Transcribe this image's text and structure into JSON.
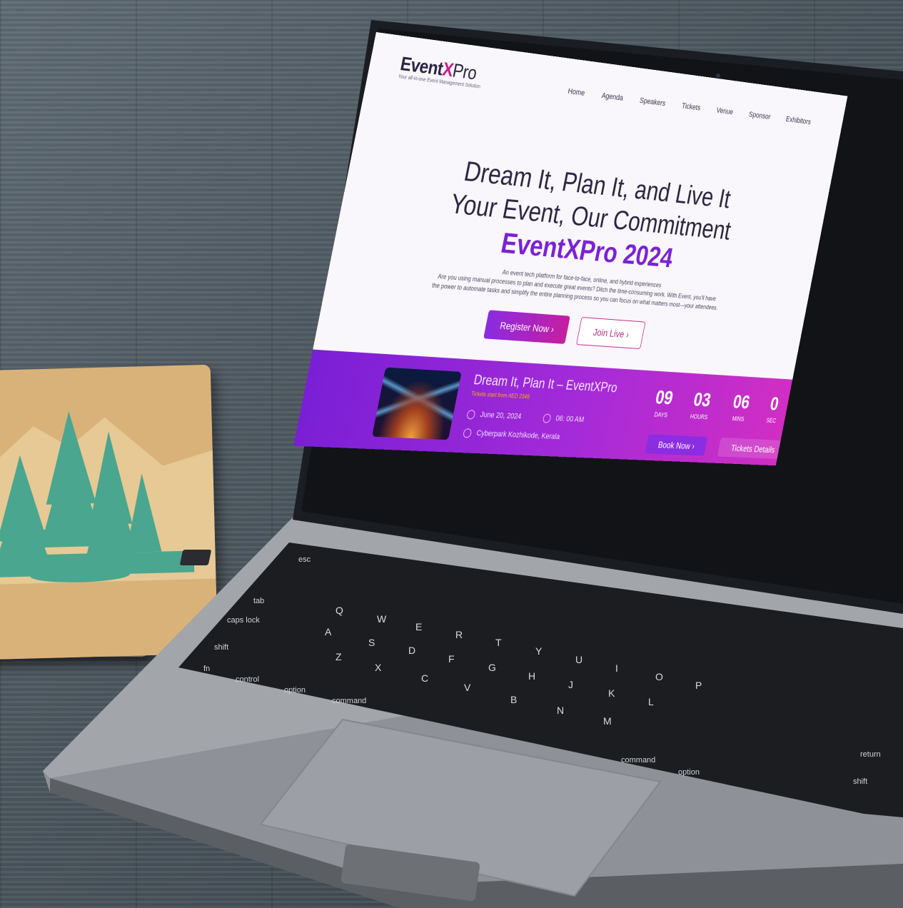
{
  "site": {
    "logo": {
      "event": "Event",
      "x": "X",
      "pro": "Pro",
      "tagline": "Your all-in-one Event Management Solution"
    },
    "nav": [
      "Home",
      "Agenda",
      "Speakers",
      "Tickets",
      "Venue",
      "Sponsor",
      "Exhibitors"
    ],
    "hero": {
      "line1": "Dream It, Plan It, and Live It",
      "line2": "Your Event, Our Commitment",
      "brand": "EventXPro 2024",
      "desc1": "An event tech platform for face-to-face, online, and hybrid experiences",
      "desc2": "Are you using manual processes to plan and execute great events? Ditch the time-consuming work. With Event, you'll have",
      "desc3": "the power to automate tasks and simplify the entire planning process so you can focus on what matters most—your attendees.",
      "register": "Register Now ›",
      "join": "Join Live ›"
    },
    "event": {
      "title": "Dream It, Plan It – EventXPro",
      "price": "Tickets start from AED 2349",
      "date": "June 20, 2024",
      "time": "06: 00 AM",
      "location": "Cyberpark Kozhikode, Kerala",
      "countdown": [
        {
          "value": "09",
          "label": "DAYS"
        },
        {
          "value": "03",
          "label": "HOURS"
        },
        {
          "value": "06",
          "label": "MINS"
        },
        {
          "value": "0",
          "label": "SEC"
        }
      ],
      "book": "Book Now ›",
      "tickets": "Tickets Details"
    }
  },
  "keyboard": {
    "keys": [
      "esc",
      "tab",
      "caps lock",
      "shift",
      "fn",
      "control",
      "option",
      "command",
      "Q",
      "W",
      "E",
      "R",
      "T",
      "Y",
      "U",
      "I",
      "O",
      "P",
      "A",
      "S",
      "D",
      "F",
      "G",
      "H",
      "J",
      "K",
      "L",
      "Z",
      "X",
      "C",
      "V",
      "B",
      "N",
      "M",
      "command",
      "option",
      "return",
      "shift"
    ]
  },
  "colors": {
    "purple": "#7b22d4",
    "magenta": "#c2208d",
    "band_start": "#7a1fd6",
    "band_end": "#d12ec3"
  }
}
